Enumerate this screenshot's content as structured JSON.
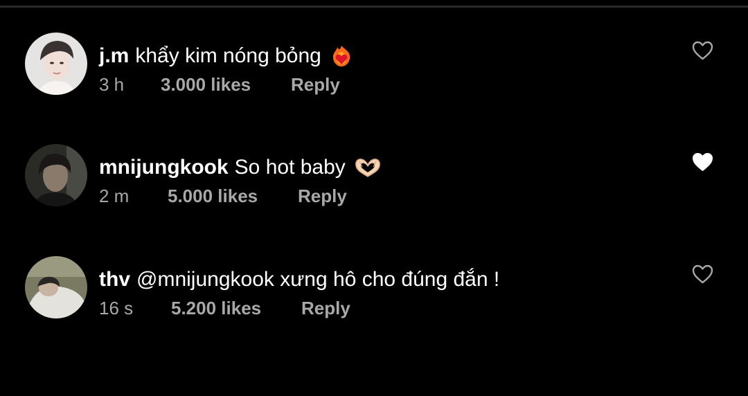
{
  "comments": [
    {
      "username": "j.m",
      "text": "khẩy kim nóng bỏng",
      "emoji": "heart-on-fire-emoji",
      "time": "3 h",
      "likes": "3.000 likes",
      "reply": "Reply",
      "liked": false
    },
    {
      "username": "mnijungkook",
      "text": "So hot baby",
      "emoji": "heart-hands-emoji",
      "time": "2 m",
      "likes": "5.000 likes",
      "reply": "Reply",
      "liked": true
    },
    {
      "username": "thv",
      "text": "@mnijungkook xưng hô cho đúng đắn !",
      "emoji": "",
      "time": "16 s",
      "likes": "5.200 likes",
      "reply": "Reply",
      "liked": false
    }
  ],
  "colors": {
    "background": "#000000",
    "primary_text": "#ffffff",
    "secondary_text": "#a8a8a8",
    "heart_outline": "#a8a8a8",
    "heart_filled": "#ffffff"
  }
}
